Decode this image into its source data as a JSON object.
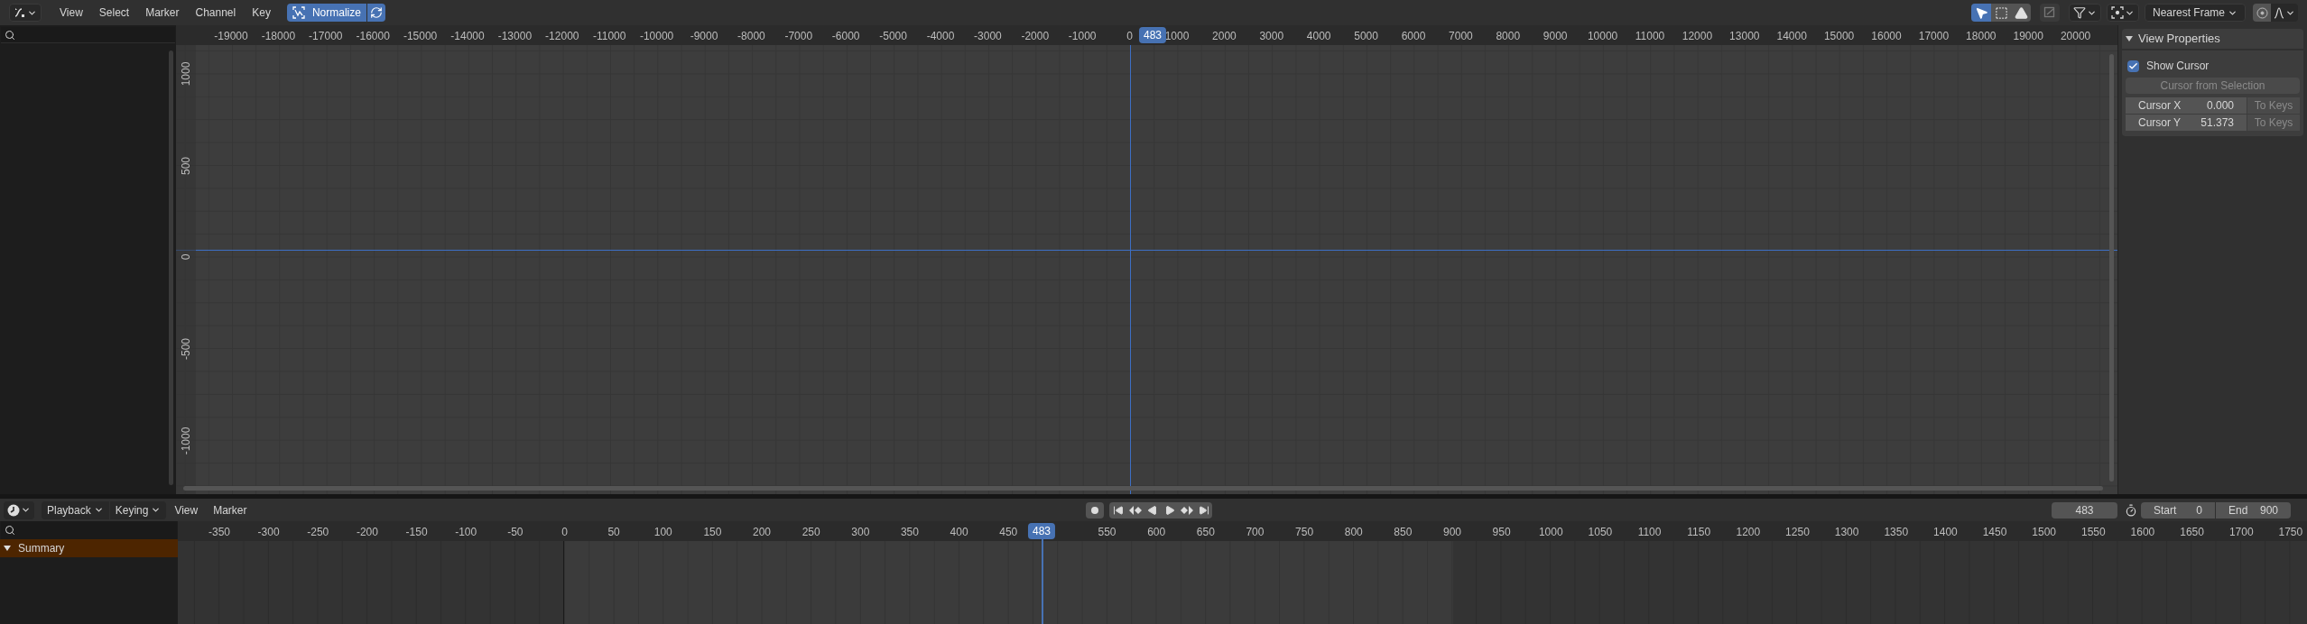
{
  "graph_editor": {
    "header": {
      "menus": [
        "View",
        "Select",
        "Marker",
        "Channel",
        "Key"
      ],
      "normalize": {
        "label": "Normalize",
        "on": true
      },
      "auto_normalize": {
        "on": true
      },
      "toggles": [
        {
          "kind": "only-selected",
          "on": true
        },
        {
          "kind": "show-handles",
          "on": false
        },
        {
          "kind": "warnings",
          "on": false
        }
      ],
      "snap_mode": "Nearest Frame"
    },
    "x_ruler": {
      "labels": [
        "-19000",
        "-18000",
        "-17000",
        "-16000",
        "-15000",
        "-14000",
        "-13000",
        "-12000",
        "-11000",
        "-10000",
        "-9000",
        "-8000",
        "-7000",
        "-6000",
        "-5000",
        "-4000",
        "-3000",
        "-2000",
        "-1000",
        "0",
        "1000",
        "2000",
        "3000",
        "4000",
        "5000",
        "6000",
        "7000",
        "8000",
        "9000",
        "10000",
        "11000",
        "12000",
        "13000",
        "14000",
        "15000",
        "16000",
        "17000",
        "18000",
        "19000",
        "20000"
      ],
      "playhead": "483"
    },
    "y_ruler": {
      "labels": [
        "1000",
        "500",
        "0",
        "-500",
        "-1000"
      ]
    },
    "sidebar": {
      "title": "View Properties",
      "expanded": true,
      "show_cursor": {
        "label": "Show Cursor",
        "checked": true
      },
      "cursor_from_selection": {
        "label": "Cursor from Selection",
        "disabled": true
      },
      "fields": [
        {
          "label": "Cursor X",
          "value": "0.000",
          "action": "To Keys"
        },
        {
          "label": "Cursor Y",
          "value": "51.373",
          "action": "To Keys"
        }
      ]
    }
  },
  "timeline": {
    "header": {
      "menus": [
        {
          "label": "Playback",
          "kind": "dropdown"
        },
        {
          "label": "Keying",
          "kind": "dropdown"
        },
        {
          "label": "View",
          "kind": "menu"
        },
        {
          "label": "Marker",
          "kind": "menu"
        }
      ],
      "auto_keying": {
        "on": false
      },
      "current_frame": "483",
      "start": {
        "label": "Start",
        "value": "0"
      },
      "end": {
        "label": "End",
        "value": "900"
      }
    },
    "ruler": {
      "labels_before_playhead": [
        "-350",
        "-300",
        "-250",
        "-200",
        "-150",
        "-100",
        "-50",
        "0",
        "50",
        "100",
        "150",
        "200",
        "250",
        "300",
        "350",
        "400",
        "450"
      ],
      "labels_after_playhead": [
        "550",
        "600",
        "650",
        "700",
        "750",
        "800",
        "850",
        "900",
        "950",
        "1000",
        "1050",
        "1100",
        "1150",
        "1200",
        "1250",
        "1300",
        "1350",
        "1400",
        "1450",
        "1500",
        "1550",
        "1600",
        "1650",
        "1700",
        "1750"
      ],
      "playhead": "483"
    },
    "channels": [
      {
        "name": "Summary",
        "expanded": true
      }
    ]
  }
}
